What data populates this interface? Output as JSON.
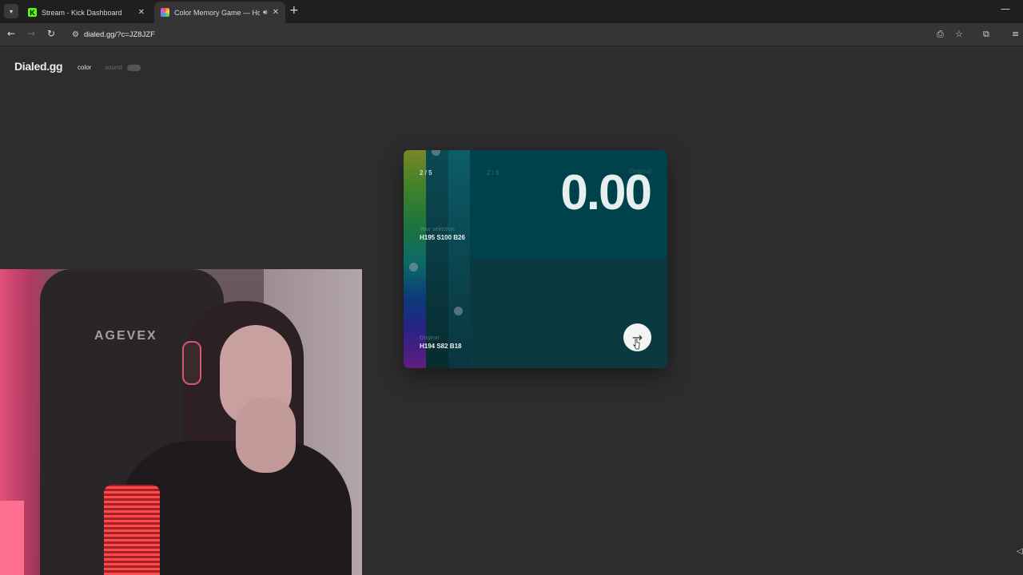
{
  "browser": {
    "tabs": [
      {
        "title": "Stream - Kick Dashboard",
        "favicon": "kick-icon",
        "active": false
      },
      {
        "title": "Color Memory Game — Ho",
        "favicon": "color-wheel-icon",
        "active": true
      }
    ],
    "new_tab_label": "+",
    "url": "dialed.gg/?c=JZ8JZF"
  },
  "header": {
    "logo": "Dialed.gg",
    "modes": {
      "color": "color",
      "sound": "sound"
    }
  },
  "game": {
    "round": "2 / 5",
    "score": "0.00",
    "original_label": "Original",
    "your_selection_label": "Your selection",
    "your_selection_value": "H195 S100 B26",
    "original_value": "H194 S82 B18",
    "next_button_icon": "arrow-right-icon",
    "colors": {
      "selection_swatch": "#00424b",
      "original_swatch": "#0a3a3f"
    }
  },
  "webcam": {
    "chair_brand": "AGEVEX"
  }
}
